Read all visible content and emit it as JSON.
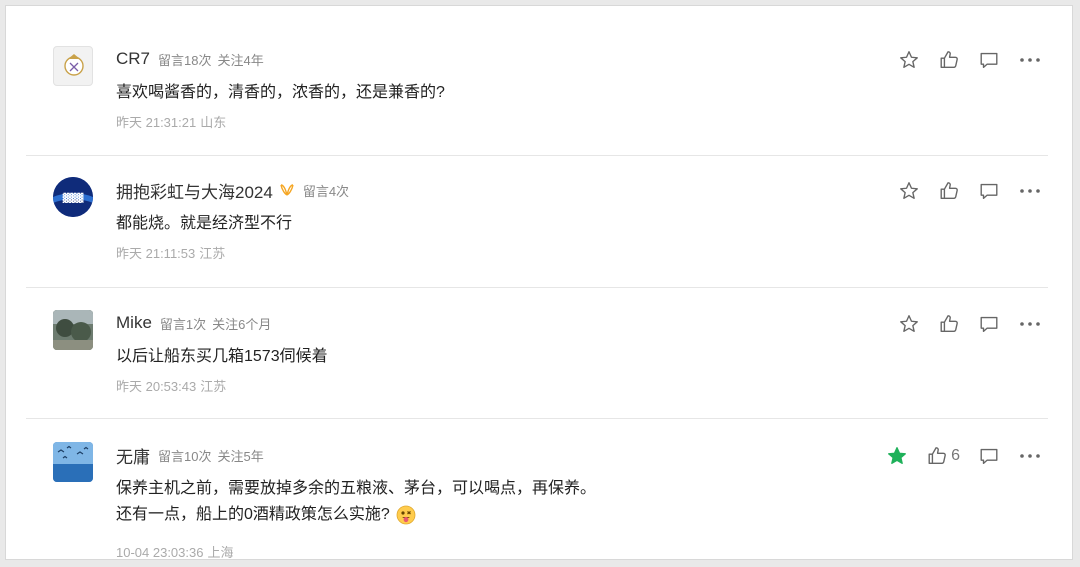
{
  "comments": [
    {
      "username": "CR7",
      "stats": [
        "留言18次",
        "关注4年"
      ],
      "lines": [
        "喜欢喝酱香的，清香的，浓香的，还是兼香的?"
      ],
      "date": "昨天 21:31:21",
      "location": "山东",
      "starred": false,
      "like_count": ""
    },
    {
      "username": "拥抱彩虹与大海2024",
      "stats": [
        "留言4次"
      ],
      "lines": [
        "都能烧。就是经济型不行"
      ],
      "date": "昨天 21:11:53",
      "location": "江苏",
      "starred": false,
      "like_count": ""
    },
    {
      "username": "Mike",
      "stats": [
        "留言1次",
        "关注6个月"
      ],
      "lines": [
        "以后让船东买几箱1573伺候着"
      ],
      "date": "昨天 20:53:43",
      "location": "江苏",
      "starred": false,
      "like_count": ""
    },
    {
      "username": "无庸",
      "stats": [
        "留言10次",
        "关注5年"
      ],
      "lines": [
        "保养主机之前，需要放掉多余的五粮液、茅台，可以喝点，再保养。",
        "还有一点，船上的0酒精政策怎么实施?"
      ],
      "date": "10-04 23:03:36",
      "location": "上海",
      "starred": true,
      "like_count": "6"
    }
  ],
  "icons": [
    "star-icon",
    "thumbs-up-icon",
    "comment-icon",
    "more-icon",
    "vip-badge-icon",
    "tongue-emoji-icon"
  ],
  "colors": {
    "star_active": "#1fb15a",
    "icon": "#666666",
    "vip": "#f5a623"
  }
}
